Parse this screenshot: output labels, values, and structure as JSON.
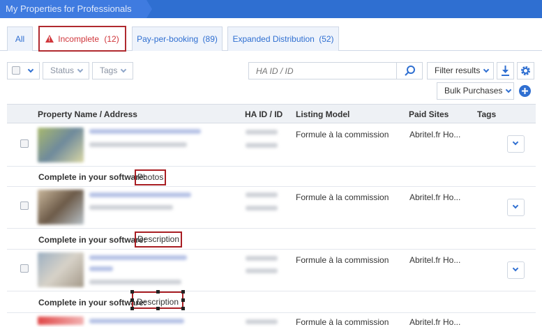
{
  "header": {
    "breadcrumb": "My Properties for Professionals"
  },
  "tabs": [
    {
      "label": "All"
    },
    {
      "label": "Incomplete",
      "count": "(12)",
      "active": true,
      "icon": "warning-icon"
    },
    {
      "label": "Pay-per-booking",
      "count": "(89)"
    },
    {
      "label": "Expanded Distribution",
      "count": "(52)"
    }
  ],
  "toolbar": {
    "status_label": "Status",
    "tags_label": "Tags",
    "search_placeholder": "HA ID / ID",
    "filter_label": "Filter results",
    "bulk_label": "Bulk Purchases"
  },
  "table": {
    "columns": [
      "Property Name / Address",
      "HA ID / ID",
      "Listing Model",
      "Paid Sites",
      "Tags"
    ],
    "rows": [
      {
        "listing_model": "Formule à la commission",
        "paid_sites": "Abritel.fr Ho...",
        "complete_label": "Complete in your software:",
        "missing": "Photos"
      },
      {
        "listing_model": "Formule à la commission",
        "paid_sites": "Abritel.fr Ho...",
        "complete_label": "Complete in your software:",
        "missing": "Description"
      },
      {
        "listing_model": "Formule à la commission",
        "paid_sites": "Abritel.fr Ho...",
        "complete_label": "Complete in your software:",
        "missing": "Description"
      },
      {
        "listing_model": "Formule à la commission",
        "paid_sites": "Abritel.fr Ho..."
      }
    ]
  },
  "colors": {
    "brand": "#2f6fd1",
    "alert": "#d0363b",
    "highlight_box": "#a81e23"
  }
}
